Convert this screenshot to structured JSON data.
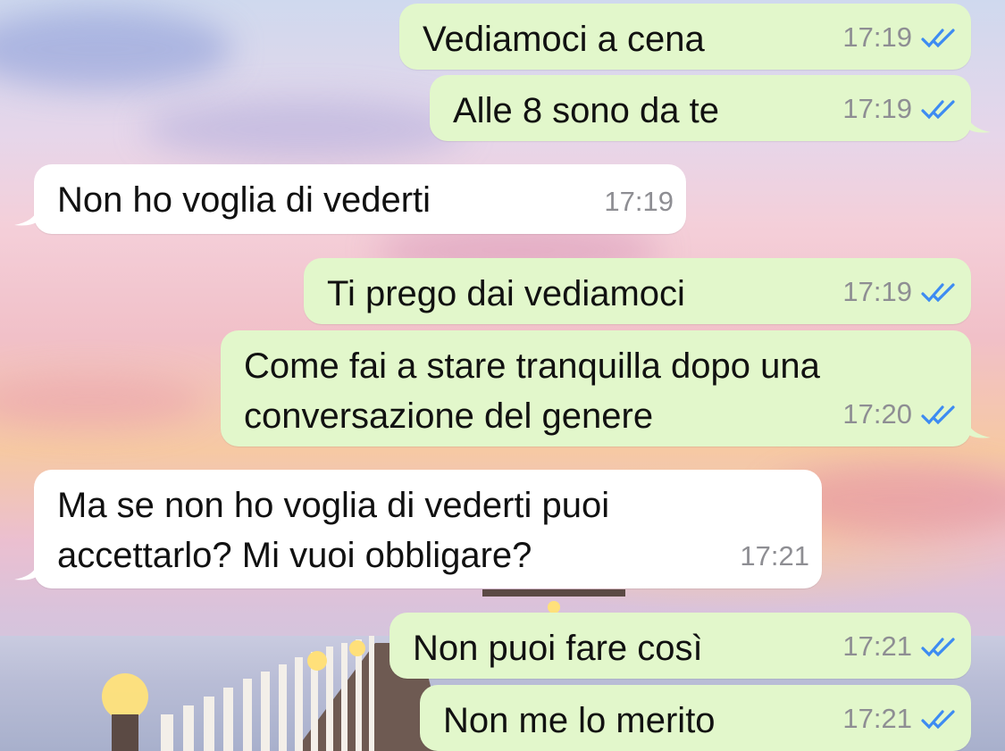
{
  "chat": {
    "messages": [
      {
        "direction": "out",
        "text": "Vediamoci a cena",
        "time": "17:19",
        "status": "read-double-check-icon"
      },
      {
        "direction": "out",
        "text": "Alle 8 sono da te",
        "time": "17:19",
        "status": "read-double-check-icon"
      },
      {
        "direction": "in",
        "text": "Non ho voglia di vederti",
        "time": "17:19"
      },
      {
        "direction": "out",
        "text": "Ti prego dai vediamoci",
        "time": "17:19",
        "status": "read-double-check-icon"
      },
      {
        "direction": "out",
        "text": "Come fai a stare tranquilla dopo una\nconversazione del genere",
        "time": "17:20",
        "status": "read-double-check-icon"
      },
      {
        "direction": "in",
        "text": "Ma se non ho voglia di vederti puoi\naccettarlo? Mi vuoi obbligare?",
        "time": "17:21"
      },
      {
        "direction": "out",
        "text": "Non puoi fare così",
        "time": "17:21",
        "status": "read-double-check-icon"
      },
      {
        "direction": "out",
        "text": "Non me lo merito",
        "time": "17:21",
        "status": "read-double-check-icon"
      }
    ]
  },
  "colors": {
    "outgoing_bubble": "#e2f7cb",
    "incoming_bubble": "#ffffff",
    "read_ticks": "#3d8bf2",
    "timestamp": "#8e8e93"
  }
}
